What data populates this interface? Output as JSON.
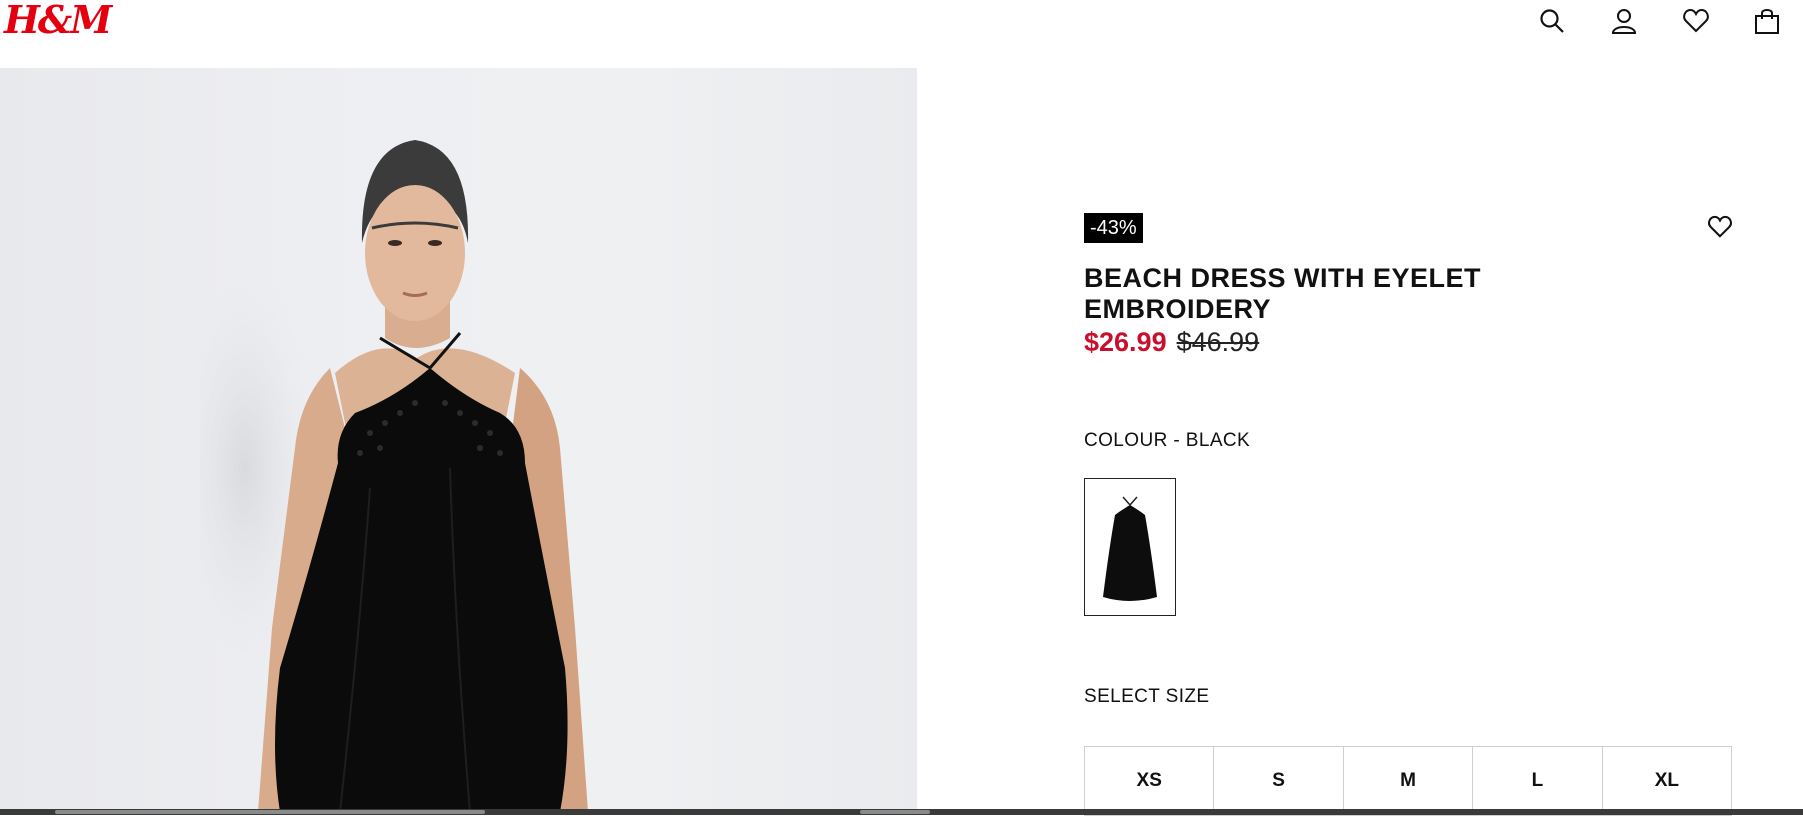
{
  "header": {
    "logo": "H&M",
    "icons": [
      "search-icon",
      "account-icon",
      "favourites-icon",
      "bag-icon"
    ]
  },
  "product": {
    "discount": "-43%",
    "title": "BEACH DRESS WITH EYELET EMBROIDERY",
    "price_sale": "$26.99",
    "price_original": "$46.99",
    "colour_label": "COLOUR - BLACK",
    "size_label": "SELECT SIZE",
    "sizes": [
      "XS",
      "S",
      "M",
      "L",
      "XL"
    ]
  },
  "colors": {
    "brand_red": "#e50010",
    "sale_red": "#c8102e",
    "badge_bg": "#000000"
  }
}
